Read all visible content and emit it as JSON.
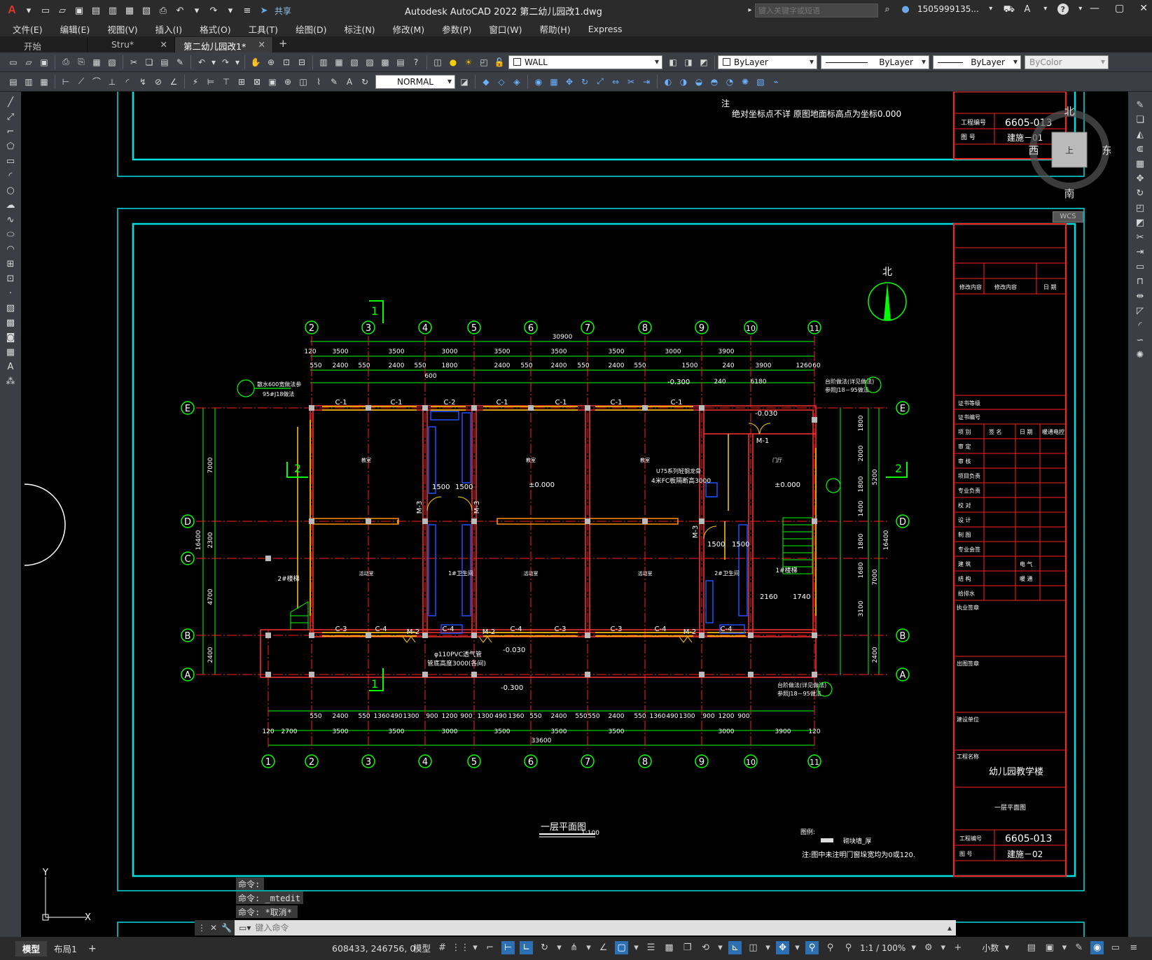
{
  "app": {
    "logo": "A",
    "title": "Autodesk AutoCAD 2022    第二幼儿园改1.dwg",
    "share": "共享",
    "search_placeholder": "键入关键字或短语",
    "user": "1505999135...",
    "help": "?"
  },
  "menu": [
    "文件(E)",
    "编辑(E)",
    "视图(V)",
    "插入(I)",
    "格式(O)",
    "工具(T)",
    "绘图(D)",
    "标注(N)",
    "修改(M)",
    "参数(P)",
    "窗口(W)",
    "帮助(H)",
    "Express"
  ],
  "tabs": [
    {
      "label": "开始"
    },
    {
      "label": "Stru*"
    },
    {
      "label": "第二幼儿园改1*"
    }
  ],
  "toolbar": {
    "layer": "WALL",
    "color": "ByLayer",
    "linetype": "ByLayer",
    "lineweight": "ByLayer",
    "plotstyle": "ByColor",
    "dimstyle": "NORMAL"
  },
  "viewcube": {
    "north": "北",
    "south": "南",
    "east": "东",
    "west": "西",
    "center": "上",
    "wcs": "WCS"
  },
  "commands": {
    "history": [
      "命令:",
      "命令: _mtedit",
      "命令: *取消*"
    ],
    "placeholder": "键入命令"
  },
  "status": {
    "tabs": [
      "模型",
      "布局1"
    ],
    "coords": "608433, 246756, 0",
    "model": "模型",
    "scale": "1:1 / 100%",
    "units": "小数"
  },
  "drawing": {
    "top_note": "绝对坐标点不详 原图地面标高点为坐标0.000",
    "top_proj_no_label": "工程编号",
    "top_proj_no": "6605-013",
    "top_dwg_no_label": "图 号",
    "top_dwg_no": "建施－01",
    "north": "北",
    "axes_h": [
      "2",
      "3",
      "4",
      "5",
      "6",
      "7",
      "8",
      "9",
      "10",
      "11"
    ],
    "axes_h_bottom": [
      "1",
      "2",
      "3",
      "4",
      "5",
      "6",
      "7",
      "8",
      "9",
      "10",
      "11"
    ],
    "axes_v": [
      "E",
      "D",
      "C",
      "B",
      "A"
    ],
    "dim_total_top": "30900",
    "dim_total_bottom": "33600",
    "dims_top_1": [
      "120",
      "3500",
      "3500",
      "3000",
      "3500",
      "3500",
      "3500",
      "3000",
      "3900"
    ],
    "dims_top_2": [
      "550",
      "2400",
      "550",
      "2400",
      "550",
      "1800",
      "600",
      "2400",
      "550",
      "2400",
      "550",
      "2400",
      "550",
      "1500",
      "240",
      "3900",
      "1260",
      "60"
    ],
    "dims_bottom_1": [
      "550",
      "2400",
      "550",
      "1360",
      "490",
      "1300",
      "900",
      "1200",
      "900",
      "1300",
      "490",
      "1360",
      "550",
      "2400",
      "550",
      "550",
      "2400",
      "550",
      "1360",
      "490",
      "1300",
      "900",
      "1200",
      "900"
    ],
    "dims_bottom_2": [
      "120",
      "2700",
      "3500",
      "3500",
      "3000",
      "3500",
      "3500",
      "3500",
      "3000",
      "3900",
      "120"
    ],
    "dims_left": [
      "7000",
      "2300",
      "4700",
      "2400",
      "16400"
    ],
    "dims_right": [
      "1800",
      "2000",
      "1800",
      "1400",
      "1800",
      "1680",
      "3100",
      "2400",
      "5200",
      "7000",
      "16400"
    ],
    "windows_top": [
      "C-1",
      "C-1",
      "C-2",
      "C-1",
      "C-1",
      "C-1",
      "C-1"
    ],
    "windows_bottom": [
      "C-3",
      "C-4",
      "M-2",
      "C-4",
      "M-2",
      "C-4",
      "C-3",
      "C-3",
      "C-4",
      "M-2",
      "C-4"
    ],
    "elev_ground": "±0.000",
    "elev_out": "-0.030",
    "elev_minus": "-0.300",
    "note_1": "散水600宽做法参",
    "note_1b": "95#J18做法",
    "note_2": "台阶做法(详见做法)",
    "note_2b": "参照J18－95做法",
    "pipe_note": "φ110PVC透气管",
    "pipe_note_b": "管底高度3000(各间)",
    "u75": "U75系列轻钢龙骨",
    "u75b": "4米FC板隔断高3000",
    "drawing_title": "一层平面图",
    "scale": "1:100",
    "legend_label": "图例:",
    "legend_item": "砌块墙_厚",
    "legend_note": "注:图中未注明门窗垛宽均为0或120.",
    "tb_project_name": "幼儿园教学楼",
    "tb_dwg_name": "一层平面图",
    "tb_proj_no_label": "工程编号",
    "tb_proj_no": "6605-013",
    "tb_dwg_no_label": "图 号",
    "tb_dwg_no": "建施－02",
    "tb_project_label": "工程名称",
    "tb_rows": [
      "证书等级",
      "证书编号",
      "审 定",
      "审 核",
      "项目负责",
      "专业负责",
      "校 对",
      "设 计",
      "制 图",
      "专业会签",
      "建 筑",
      "结 构",
      "给排水"
    ],
    "tb_header": [
      "项 别",
      "签 名",
      "日 期",
      "暖通电控"
    ],
    "tb_col2": [
      "电 气",
      "暖 通"
    ],
    "tb_sections": [
      "执业签章",
      "出图签章",
      "建设单位"
    ],
    "tb_rev": [
      "修改内容",
      "修改内容",
      "日 期"
    ],
    "room_labels": [
      "教室",
      "教室",
      "教室",
      "门厅",
      "活动室",
      "活动室",
      "活动室"
    ],
    "toilet_labels": [
      "1#卫生间",
      "2#卫生间"
    ],
    "stair_1": "1#楼梯",
    "stair_2": "2#楼梯",
    "door_m1": "M-1",
    "door_m3": "M-3",
    "dim_1500": "1500",
    "dim_2160": "2160",
    "dim_1740": "1740",
    "dim_6180": "6180"
  }
}
